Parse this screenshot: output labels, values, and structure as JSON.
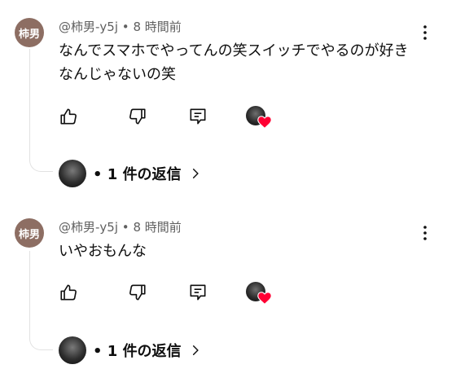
{
  "comments": [
    {
      "avatar_text": "柿男",
      "author": "@柿男-y5j",
      "separator": "•",
      "time": "8 時間前",
      "text": "なんでスマホでやってんの笑スイッチでやるのが好きなんじゃないの笑",
      "replies_label": "• 1 件の返信"
    },
    {
      "avatar_text": "柿男",
      "author": "@柿男-y5j",
      "separator": "•",
      "time": "8 時間前",
      "text": "いやおもんな",
      "replies_label": "• 1 件の返信"
    }
  ],
  "colors": {
    "avatar_bg": "#8d6e63",
    "heart": "#ff0033",
    "meta_text": "#606060",
    "thread_line": "#e2e2e2"
  },
  "icons": [
    "more-vert-icon",
    "like-icon",
    "dislike-icon",
    "reply-icon",
    "creator-heart-icon",
    "chevron-right-icon"
  ]
}
